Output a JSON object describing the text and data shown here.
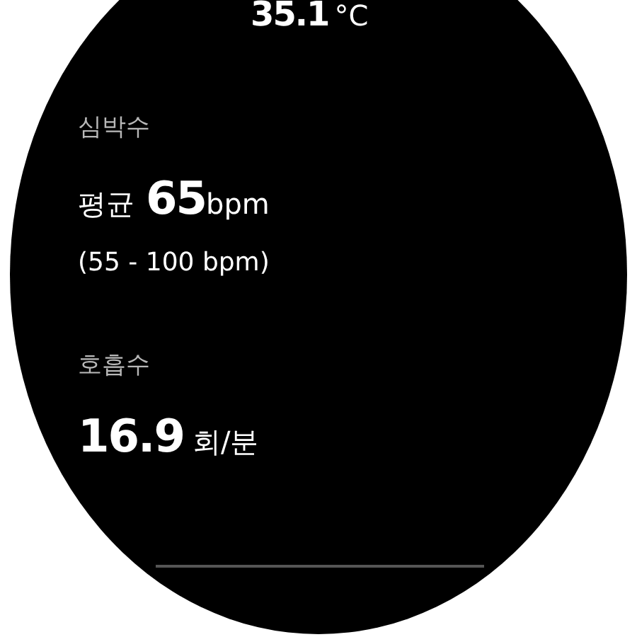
{
  "temperature": {
    "value": "35.1",
    "unit": "°C"
  },
  "heart_rate": {
    "label": "심박수",
    "prefix": "평균",
    "value": "65",
    "unit": "bpm",
    "range": "(55 - 100 bpm)"
  },
  "respiration": {
    "label": "호흡수",
    "value": "16.9",
    "unit": "회/분"
  }
}
